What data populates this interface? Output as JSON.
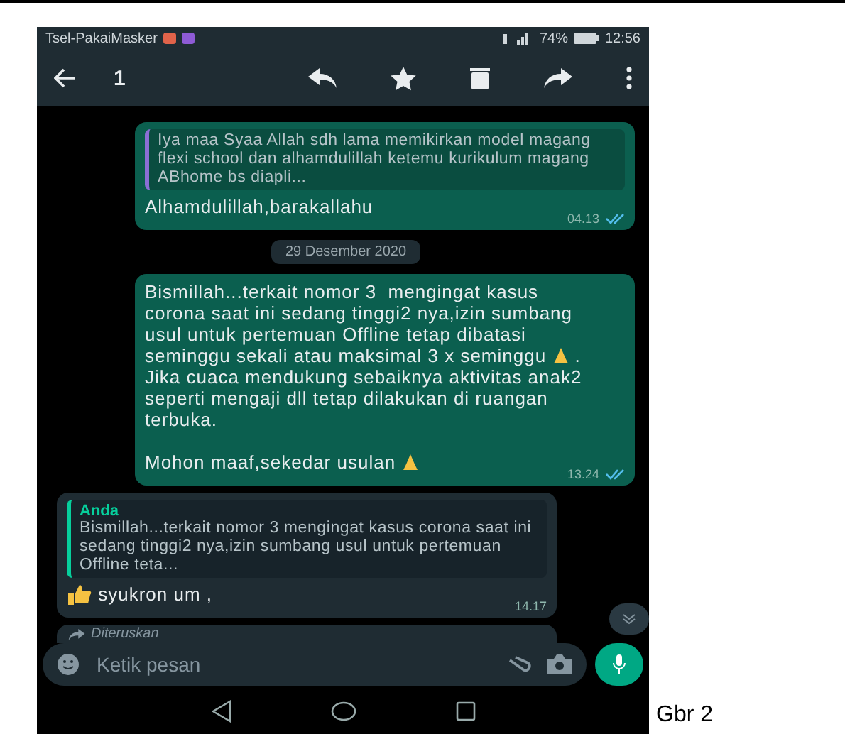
{
  "status_bar": {
    "carrier": "Tsel-PakaiMasker",
    "battery": "74%",
    "time": "12:56"
  },
  "toolbar": {
    "selected_count": "1"
  },
  "messages": [
    {
      "kind": "out",
      "quote": {
        "text": "Iya maa Syaa Allah sdh lama memikirkan model magang flexi school dan alhamdulillah ketemu kurikulum magang ABhome bs diapli..."
      },
      "body": [
        {
          "kind": "text",
          "text": "Alhamdulillah,barakallahu"
        }
      ],
      "time": "04.13",
      "read": true
    },
    {
      "kind": "date",
      "text": "29 Desember 2020"
    },
    {
      "kind": "out",
      "body": [
        {
          "kind": "text",
          "text": "Bismillah...terkait nomor 3  mengingat kasus corona saat ini sedang tinggi2 nya,izin sumbang usul untuk pertemuan Offline tetap dibatasi seminggu sekali atau maksimal 3 x seminggu "
        },
        {
          "kind": "pray"
        },
        {
          "kind": "text",
          "text": " . Jika cuaca mendukung sebaiknya aktivitas anak2 seperti mengaji dll tetap dilakukan di ruangan terbuka.\n\nMohon maaf,sekedar usulan "
        },
        {
          "kind": "pray"
        }
      ],
      "time": "13.24",
      "read": true
    },
    {
      "kind": "in",
      "quote": {
        "author": "Anda",
        "text": "Bismillah...terkait nomor 3  mengingat kasus corona saat ini sedang tinggi2 nya,izin sumbang usul untuk pertemuan Offline teta..."
      },
      "body": [
        {
          "kind": "thumb"
        },
        {
          "kind": "text",
          "text": " syukron um ,"
        }
      ],
      "time": "14.17"
    },
    {
      "kind": "forwarded",
      "text": "Diteruskan"
    }
  ],
  "composer": {
    "placeholder": "Ketik pesan"
  },
  "caption": "Gbr 2"
}
